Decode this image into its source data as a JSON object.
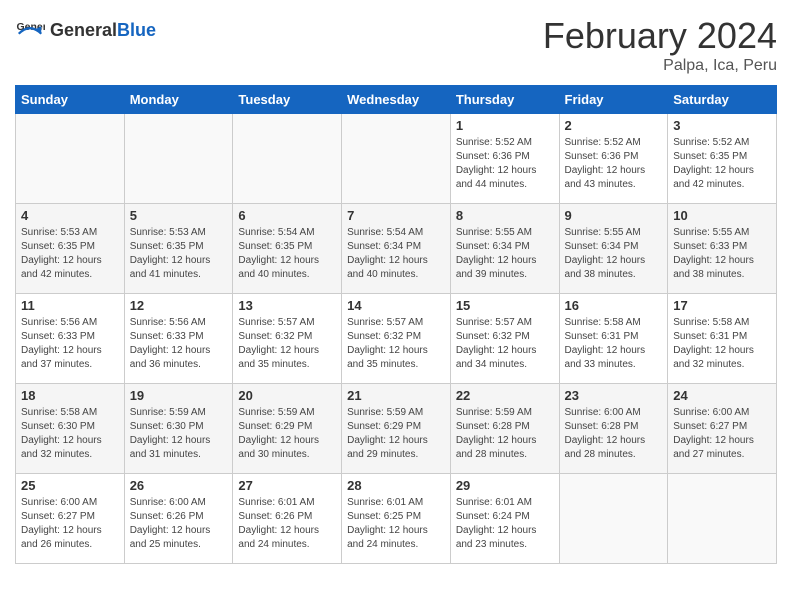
{
  "header": {
    "logo_general": "General",
    "logo_blue": "Blue",
    "month_title": "February 2024",
    "location": "Palpa, Ica, Peru"
  },
  "weekdays": [
    "Sunday",
    "Monday",
    "Tuesday",
    "Wednesday",
    "Thursday",
    "Friday",
    "Saturday"
  ],
  "weeks": [
    [
      {
        "day": "",
        "info": ""
      },
      {
        "day": "",
        "info": ""
      },
      {
        "day": "",
        "info": ""
      },
      {
        "day": "",
        "info": ""
      },
      {
        "day": "1",
        "info": "Sunrise: 5:52 AM\nSunset: 6:36 PM\nDaylight: 12 hours\nand 44 minutes."
      },
      {
        "day": "2",
        "info": "Sunrise: 5:52 AM\nSunset: 6:36 PM\nDaylight: 12 hours\nand 43 minutes."
      },
      {
        "day": "3",
        "info": "Sunrise: 5:52 AM\nSunset: 6:35 PM\nDaylight: 12 hours\nand 42 minutes."
      }
    ],
    [
      {
        "day": "4",
        "info": "Sunrise: 5:53 AM\nSunset: 6:35 PM\nDaylight: 12 hours\nand 42 minutes."
      },
      {
        "day": "5",
        "info": "Sunrise: 5:53 AM\nSunset: 6:35 PM\nDaylight: 12 hours\nand 41 minutes."
      },
      {
        "day": "6",
        "info": "Sunrise: 5:54 AM\nSunset: 6:35 PM\nDaylight: 12 hours\nand 40 minutes."
      },
      {
        "day": "7",
        "info": "Sunrise: 5:54 AM\nSunset: 6:34 PM\nDaylight: 12 hours\nand 40 minutes."
      },
      {
        "day": "8",
        "info": "Sunrise: 5:55 AM\nSunset: 6:34 PM\nDaylight: 12 hours\nand 39 minutes."
      },
      {
        "day": "9",
        "info": "Sunrise: 5:55 AM\nSunset: 6:34 PM\nDaylight: 12 hours\nand 38 minutes."
      },
      {
        "day": "10",
        "info": "Sunrise: 5:55 AM\nSunset: 6:33 PM\nDaylight: 12 hours\nand 38 minutes."
      }
    ],
    [
      {
        "day": "11",
        "info": "Sunrise: 5:56 AM\nSunset: 6:33 PM\nDaylight: 12 hours\nand 37 minutes."
      },
      {
        "day": "12",
        "info": "Sunrise: 5:56 AM\nSunset: 6:33 PM\nDaylight: 12 hours\nand 36 minutes."
      },
      {
        "day": "13",
        "info": "Sunrise: 5:57 AM\nSunset: 6:32 PM\nDaylight: 12 hours\nand 35 minutes."
      },
      {
        "day": "14",
        "info": "Sunrise: 5:57 AM\nSunset: 6:32 PM\nDaylight: 12 hours\nand 35 minutes."
      },
      {
        "day": "15",
        "info": "Sunrise: 5:57 AM\nSunset: 6:32 PM\nDaylight: 12 hours\nand 34 minutes."
      },
      {
        "day": "16",
        "info": "Sunrise: 5:58 AM\nSunset: 6:31 PM\nDaylight: 12 hours\nand 33 minutes."
      },
      {
        "day": "17",
        "info": "Sunrise: 5:58 AM\nSunset: 6:31 PM\nDaylight: 12 hours\nand 32 minutes."
      }
    ],
    [
      {
        "day": "18",
        "info": "Sunrise: 5:58 AM\nSunset: 6:30 PM\nDaylight: 12 hours\nand 32 minutes."
      },
      {
        "day": "19",
        "info": "Sunrise: 5:59 AM\nSunset: 6:30 PM\nDaylight: 12 hours\nand 31 minutes."
      },
      {
        "day": "20",
        "info": "Sunrise: 5:59 AM\nSunset: 6:29 PM\nDaylight: 12 hours\nand 30 minutes."
      },
      {
        "day": "21",
        "info": "Sunrise: 5:59 AM\nSunset: 6:29 PM\nDaylight: 12 hours\nand 29 minutes."
      },
      {
        "day": "22",
        "info": "Sunrise: 5:59 AM\nSunset: 6:28 PM\nDaylight: 12 hours\nand 28 minutes."
      },
      {
        "day": "23",
        "info": "Sunrise: 6:00 AM\nSunset: 6:28 PM\nDaylight: 12 hours\nand 28 minutes."
      },
      {
        "day": "24",
        "info": "Sunrise: 6:00 AM\nSunset: 6:27 PM\nDaylight: 12 hours\nand 27 minutes."
      }
    ],
    [
      {
        "day": "25",
        "info": "Sunrise: 6:00 AM\nSunset: 6:27 PM\nDaylight: 12 hours\nand 26 minutes."
      },
      {
        "day": "26",
        "info": "Sunrise: 6:00 AM\nSunset: 6:26 PM\nDaylight: 12 hours\nand 25 minutes."
      },
      {
        "day": "27",
        "info": "Sunrise: 6:01 AM\nSunset: 6:26 PM\nDaylight: 12 hours\nand 24 minutes."
      },
      {
        "day": "28",
        "info": "Sunrise: 6:01 AM\nSunset: 6:25 PM\nDaylight: 12 hours\nand 24 minutes."
      },
      {
        "day": "29",
        "info": "Sunrise: 6:01 AM\nSunset: 6:24 PM\nDaylight: 12 hours\nand 23 minutes."
      },
      {
        "day": "",
        "info": ""
      },
      {
        "day": "",
        "info": ""
      }
    ]
  ]
}
